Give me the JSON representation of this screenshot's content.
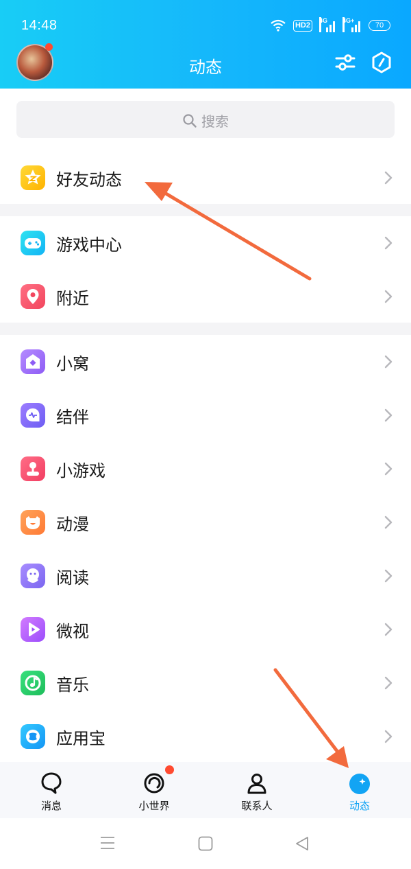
{
  "status_bar": {
    "time": "14:48",
    "hd": "HD2",
    "net1": "4G",
    "net2": "4G+",
    "battery": "70"
  },
  "header": {
    "title": "动态",
    "filter_icon": "sliders-icon",
    "settings_icon": "hexagon-icon"
  },
  "search": {
    "label": "搜索"
  },
  "menu": {
    "friends": "好友动态",
    "game_center": "游戏中心",
    "nearby": "附近",
    "xiaowo": "小窝",
    "jieban": "结伴",
    "mini_games": "小游戏",
    "anime": "动漫",
    "reading": "阅读",
    "weishi": "微视",
    "music": "音乐",
    "app_store": "应用宝"
  },
  "bottom_nav": {
    "messages": "消息",
    "small_world": "小世界",
    "contacts": "联系人",
    "moments": "动态"
  },
  "colors": {
    "header_start": "#18cdf6",
    "header_end": "#0aa8ff",
    "active_tab": "#12a4f4",
    "annotation_arrow": "#f26a3d",
    "notification_dot": "#ff4a30"
  }
}
